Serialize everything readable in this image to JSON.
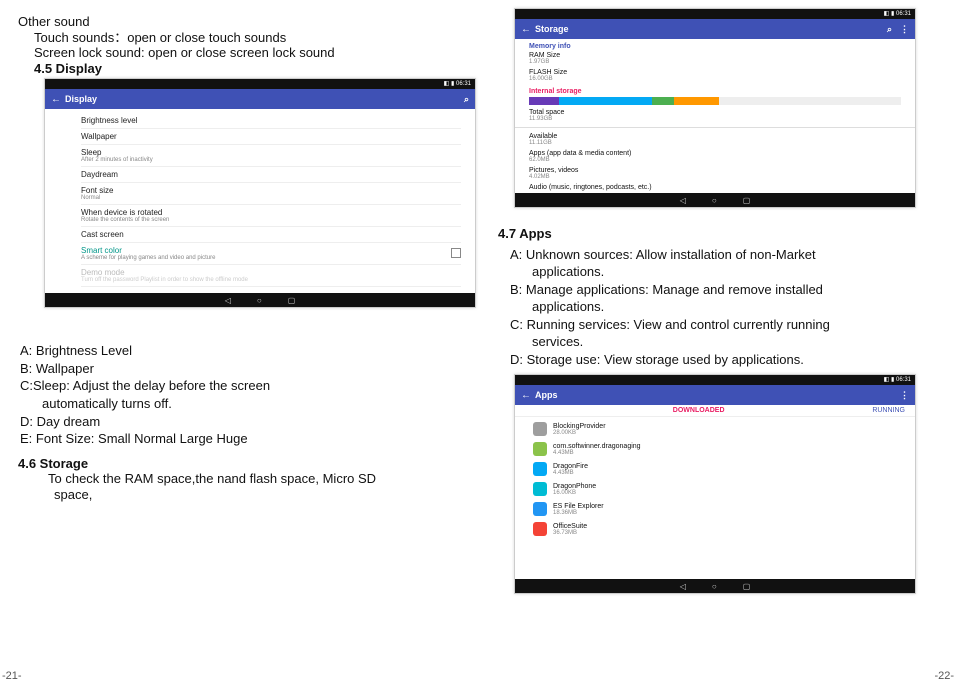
{
  "leftPage": {
    "pageNum": "-21-",
    "otherSound": "Other sound",
    "touchSounds": "Touch sounds：open or close touch sounds",
    "screenLock": "Screen lock sound: open or close screen lock sound",
    "section45": "4.5 Display",
    "letterA": "A: Brightness Level",
    "letterB": "B: Wallpaper",
    "letterC1": "C:Sleep: Adjust the delay before the screen",
    "letterC2": "automatically turns off.",
    "letterD": "D: Day dream",
    "letterE": "E: Font Size: Small Normal Large Huge",
    "section46": "4.6 Storage",
    "storageText1": "To check the RAM space,the nand flash space, Micro SD",
    "storageText2": "space,"
  },
  "rightPage": {
    "pageNum": "-22-",
    "section47": "4.7 Apps",
    "a1": "A: Unknown sources: Allow installation of non-Market",
    "a2": "applications.",
    "b1": "B: Manage applications: Manage and remove installed",
    "b2": "applications.",
    "c1": "C: Running services: View and control currently running",
    "c2": "services.",
    "d1": "D: Storage use: View storage used by applications."
  },
  "displayShot": {
    "title": "Display",
    "time": "06:31",
    "rows": [
      {
        "t": "Brightness level"
      },
      {
        "t": "Wallpaper"
      },
      {
        "t": "Sleep",
        "s": "After 2 minutes of inactivity"
      },
      {
        "t": "Daydream"
      },
      {
        "t": "Font size",
        "s": "Normal"
      },
      {
        "t": "When device is rotated",
        "s": "Rotate the contents of the screen"
      },
      {
        "t": "Cast screen"
      },
      {
        "t": "Smart color",
        "accent": true,
        "s": "A scheme for playing games and video and picture",
        "check": true
      },
      {
        "t": "Demo mode",
        "faded": true,
        "s": "Turn off the password Playlist in order to show the offline mode"
      }
    ]
  },
  "storageShot": {
    "title": "Storage",
    "time": "06:31",
    "memInfo": "Memory info",
    "ramLabel": "RAM Size",
    "ramVal": "1.97GB",
    "flashLabel": "FLASH Size",
    "flashVal": "16.00GB",
    "internal": "Internal storage",
    "barSegments": [
      {
        "w": "8%",
        "c": "#673ab7"
      },
      {
        "w": "25%",
        "c": "#03a9f4"
      },
      {
        "w": "6%",
        "c": "#4caf50"
      },
      {
        "w": "12%",
        "c": "#ff9800"
      }
    ],
    "totalLabel": "Total space",
    "totalVal": "11.93GB",
    "rows": [
      {
        "t": "Available",
        "v": "11.11GB"
      },
      {
        "t": "Apps (app data & media content)",
        "v": "62.0MB"
      },
      {
        "t": "Pictures, videos",
        "v": "4.02MB"
      },
      {
        "t": "Audio (music, ringtones, podcasts, etc.)",
        "v": ""
      }
    ]
  },
  "appsShot": {
    "title": "Apps",
    "time": "06:31",
    "tabLeft": "DOWNLOADED",
    "tabRight": "RUNNING",
    "apps": [
      {
        "n": "BlockingProvider",
        "s": "28.00KB",
        "c": "#9e9e9e"
      },
      {
        "n": "com.softwinner.dragonaging",
        "s": "4.43MB",
        "c": "#8bc34a"
      },
      {
        "n": "DragonFire",
        "s": "4.43MB",
        "c": "#03a9f4"
      },
      {
        "n": "DragonPhone",
        "s": "16.00KB",
        "c": "#00bcd4"
      },
      {
        "n": "ES File Explorer",
        "s": "18.36MB",
        "c": "#2196f3"
      },
      {
        "n": "OfficeSuite",
        "s": "36.73MB",
        "c": "#f44336"
      }
    ]
  },
  "nav": {
    "back": "◁",
    "home": "○",
    "recent": "▢"
  }
}
